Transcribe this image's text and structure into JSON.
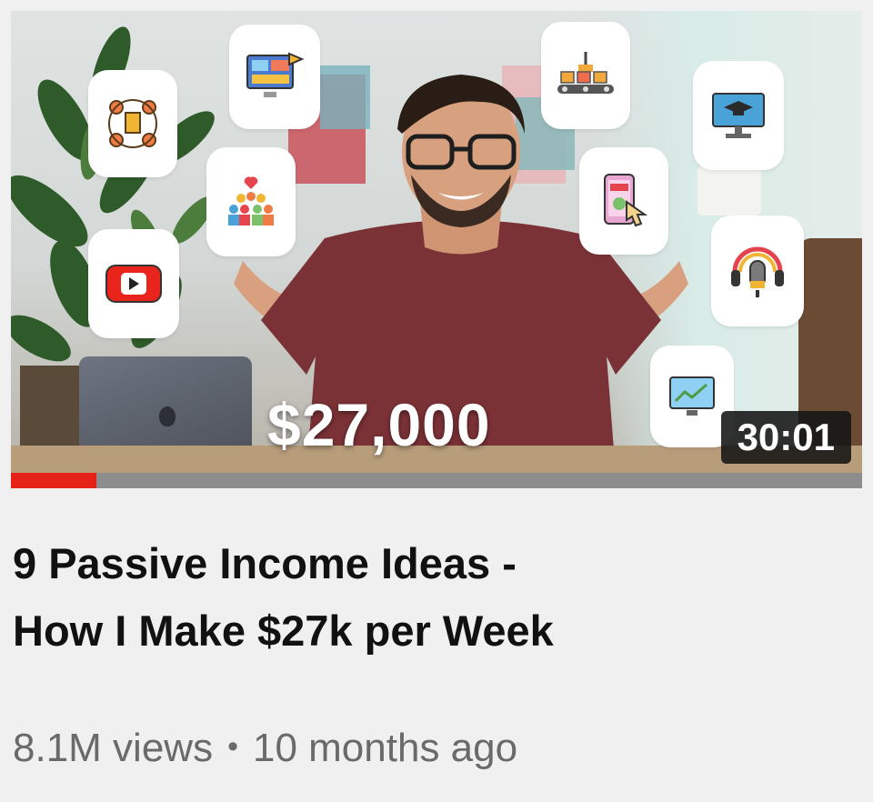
{
  "video": {
    "thumbnail_overlay_text": "$27,000",
    "duration": "30:01",
    "watch_progress": 0.1,
    "title_line1": "9 Passive Income Ideas -",
    "title_line2": "How I Make $27k per Week",
    "views": "8.1M views",
    "separator": "•",
    "published": "10 months ago"
  },
  "thumbnail_icons": [
    "network-people-icon",
    "video-editing-icon",
    "conveyor-belt-icon",
    "graduation-course-icon",
    "audience-heart-icon",
    "tap-phone-icon",
    "youtube-play-icon",
    "podcast-microphone-icon",
    "analytics-chart-icon"
  ],
  "colors": {
    "background": "#f0f0f0",
    "progress_watched": "#e62117",
    "progress_track": "#8d8d8d",
    "title": "#111111",
    "meta": "#6a6a6a",
    "badge": "#141414"
  }
}
